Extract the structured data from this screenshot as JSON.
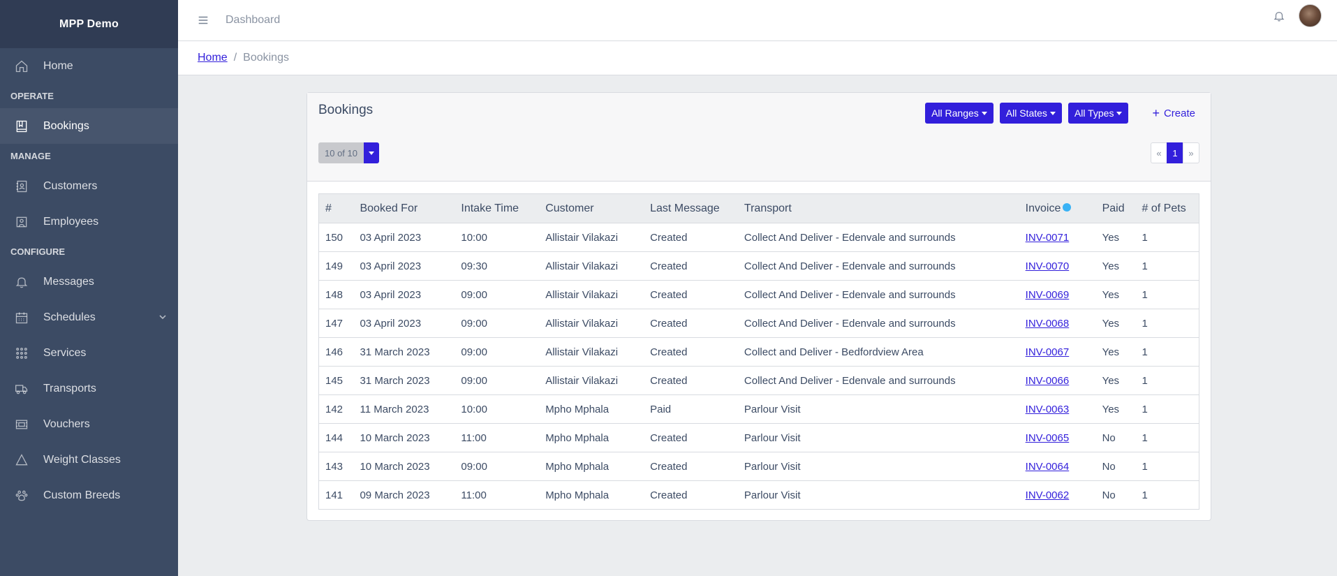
{
  "brand": "MPP Demo",
  "sidebar": {
    "sections": [
      {
        "title": "",
        "items": [
          {
            "label": "Home",
            "icon": "home-icon"
          }
        ]
      },
      {
        "title": "OPERATE",
        "items": [
          {
            "label": "Bookings",
            "icon": "book-icon",
            "active": true
          }
        ]
      },
      {
        "title": "MANAGE",
        "items": [
          {
            "label": "Customers",
            "icon": "address-book-icon"
          },
          {
            "label": "Employees",
            "icon": "badge-icon"
          }
        ]
      },
      {
        "title": "CONFIGURE",
        "items": [
          {
            "label": "Messages",
            "icon": "bell-icon"
          },
          {
            "label": "Schedules",
            "icon": "calendar-icon",
            "expandable": true
          },
          {
            "label": "Services",
            "icon": "grid-icon"
          },
          {
            "label": "Transports",
            "icon": "truck-icon"
          },
          {
            "label": "Vouchers",
            "icon": "voucher-icon"
          },
          {
            "label": "Weight Classes",
            "icon": "triangle-icon"
          },
          {
            "label": "Custom Breeds",
            "icon": "paw-icon"
          }
        ]
      }
    ]
  },
  "header": {
    "link": "Dashboard"
  },
  "breadcrumb": {
    "home": "Home",
    "current": "Bookings"
  },
  "card": {
    "title": "Bookings",
    "filters": {
      "ranges": "All Ranges",
      "states": "All States",
      "types": "All Types"
    },
    "create": "Create",
    "count": "10 of 10",
    "pager": {
      "prev": "«",
      "page": "1",
      "next": "»"
    }
  },
  "table": {
    "headers": [
      "#",
      "Booked For",
      "Intake Time",
      "Customer",
      "Last Message",
      "Transport",
      "Invoice",
      "Paid",
      "# of Pets"
    ],
    "rows": [
      [
        "150",
        "03 April 2023",
        "10:00",
        "Allistair Vilakazi",
        "Created",
        "Collect And Deliver - Edenvale and surrounds",
        "INV-0071",
        "Yes",
        "1"
      ],
      [
        "149",
        "03 April 2023",
        "09:30",
        "Allistair Vilakazi",
        "Created",
        "Collect And Deliver - Edenvale and surrounds",
        "INV-0070",
        "Yes",
        "1"
      ],
      [
        "148",
        "03 April 2023",
        "09:00",
        "Allistair Vilakazi",
        "Created",
        "Collect And Deliver - Edenvale and surrounds",
        "INV-0069",
        "Yes",
        "1"
      ],
      [
        "147",
        "03 April 2023",
        "09:00",
        "Allistair Vilakazi",
        "Created",
        "Collect And Deliver - Edenvale and surrounds",
        "INV-0068",
        "Yes",
        "1"
      ],
      [
        "146",
        "31 March 2023",
        "09:00",
        "Allistair Vilakazi",
        "Created",
        "Collect and Deliver - Bedfordview Area",
        "INV-0067",
        "Yes",
        "1"
      ],
      [
        "145",
        "31 March 2023",
        "09:00",
        "Allistair Vilakazi",
        "Created",
        "Collect And Deliver - Edenvale and surrounds",
        "INV-0066",
        "Yes",
        "1"
      ],
      [
        "142",
        "11 March 2023",
        "10:00",
        "Mpho Mphala",
        "Paid",
        "Parlour Visit",
        "INV-0063",
        "Yes",
        "1"
      ],
      [
        "144",
        "10 March 2023",
        "11:00",
        "Mpho Mphala",
        "Created",
        "Parlour Visit",
        "INV-0065",
        "No",
        "1"
      ],
      [
        "143",
        "10 March 2023",
        "09:00",
        "Mpho Mphala",
        "Created",
        "Parlour Visit",
        "INV-0064",
        "No",
        "1"
      ],
      [
        "141",
        "09 March 2023",
        "11:00",
        "Mpho Mphala",
        "Created",
        "Parlour Visit",
        "INV-0062",
        "No",
        "1"
      ]
    ]
  },
  "colors": {
    "primary": "#321fdb",
    "sidebar": "#3c4b64",
    "brand_bg": "#303c54",
    "info": "#39b2f5"
  }
}
